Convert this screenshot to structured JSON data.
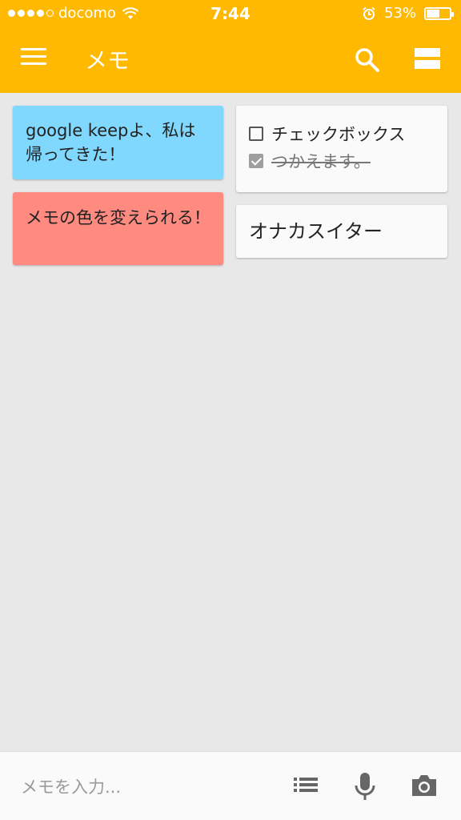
{
  "status": {
    "carrier": "docomo",
    "time": "7:44",
    "battery_percent": "53%",
    "battery_level": 0.53
  },
  "toolbar": {
    "title": "メモ",
    "icons": [
      "menu-icon",
      "search-icon",
      "view-toggle-icon"
    ]
  },
  "notes": [
    {
      "color": "#80d8ff",
      "text": "google keepよ、私は帰ってきた！"
    },
    {
      "color": "#ff8a80",
      "text": "メモの色を変えられる！"
    }
  ],
  "checklist_note": {
    "items": [
      {
        "text": "チェックボックス",
        "checked": false
      },
      {
        "text": "つかえます。",
        "checked": true
      }
    ]
  },
  "single_note": {
    "text": "オナカスイター"
  },
  "bottom": {
    "placeholder": "メモを入力...",
    "icons": [
      "list-icon",
      "mic-icon",
      "camera-icon"
    ]
  },
  "colors": {
    "appbar": "#ffb900",
    "background": "#e8e8e8"
  }
}
